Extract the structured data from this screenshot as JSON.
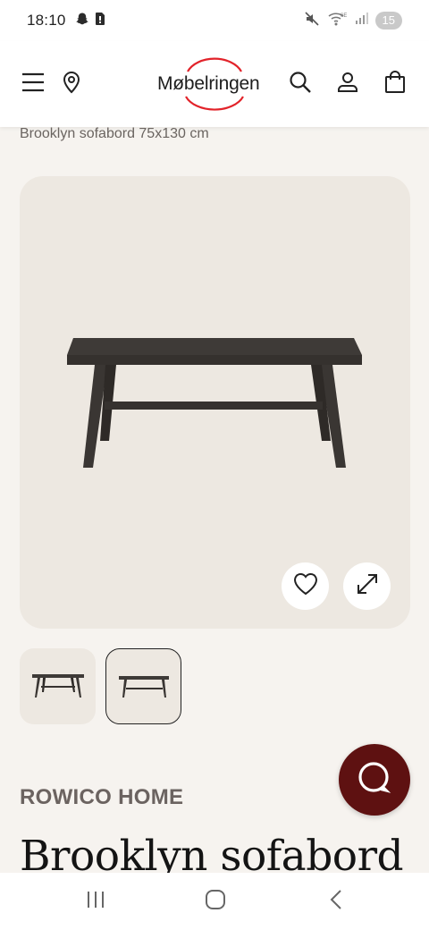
{
  "status_bar": {
    "time": "18:10",
    "battery_level": "15",
    "left_icons": [
      "snapchat-icon",
      "sim-icon"
    ],
    "right_icons": [
      "mute-icon",
      "wifi-icon",
      "signal-icon"
    ]
  },
  "header": {
    "logo_text": "Møbelringen",
    "accent_color": "#e2232a",
    "icons": [
      "menu-icon",
      "location-pin-icon",
      "search-icon",
      "user-icon",
      "shopping-bag-icon"
    ]
  },
  "breadcrumb": {
    "current": "Brooklyn sofabord 75x130 cm"
  },
  "gallery": {
    "selected_thumbnail_index": 2,
    "thumbnail_count": 2
  },
  "product": {
    "brand": "ROWICO HOME",
    "title": "Brooklyn sofabord"
  },
  "chat": {
    "color": "#5e1111"
  }
}
